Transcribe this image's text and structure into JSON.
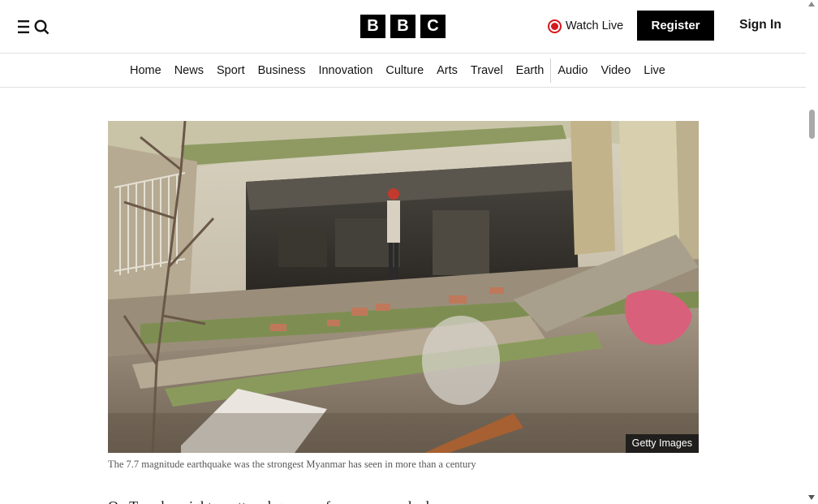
{
  "header": {
    "menu_search_icons": [
      "menu-icon",
      "search-icon"
    ],
    "logo_letters": [
      "B",
      "B",
      "C"
    ],
    "watch_live_label": "Watch Live",
    "register_label": "Register",
    "signin_label": "Sign In"
  },
  "nav": {
    "items": [
      "Home",
      "News",
      "Sport",
      "Business",
      "Innovation",
      "Culture",
      "Arts",
      "Travel",
      "Earth",
      "Audio",
      "Video",
      "Live"
    ]
  },
  "article": {
    "image_credit": "Getty Images",
    "caption": "The 7.7 magnitude earthquake was the strongest Myanmar has seen in more than a century",
    "body_first_line": "On Tuesday night, scattered groups of rescuers worked"
  },
  "colors": {
    "live_red": "#d4181f",
    "brand_black": "#000000"
  }
}
